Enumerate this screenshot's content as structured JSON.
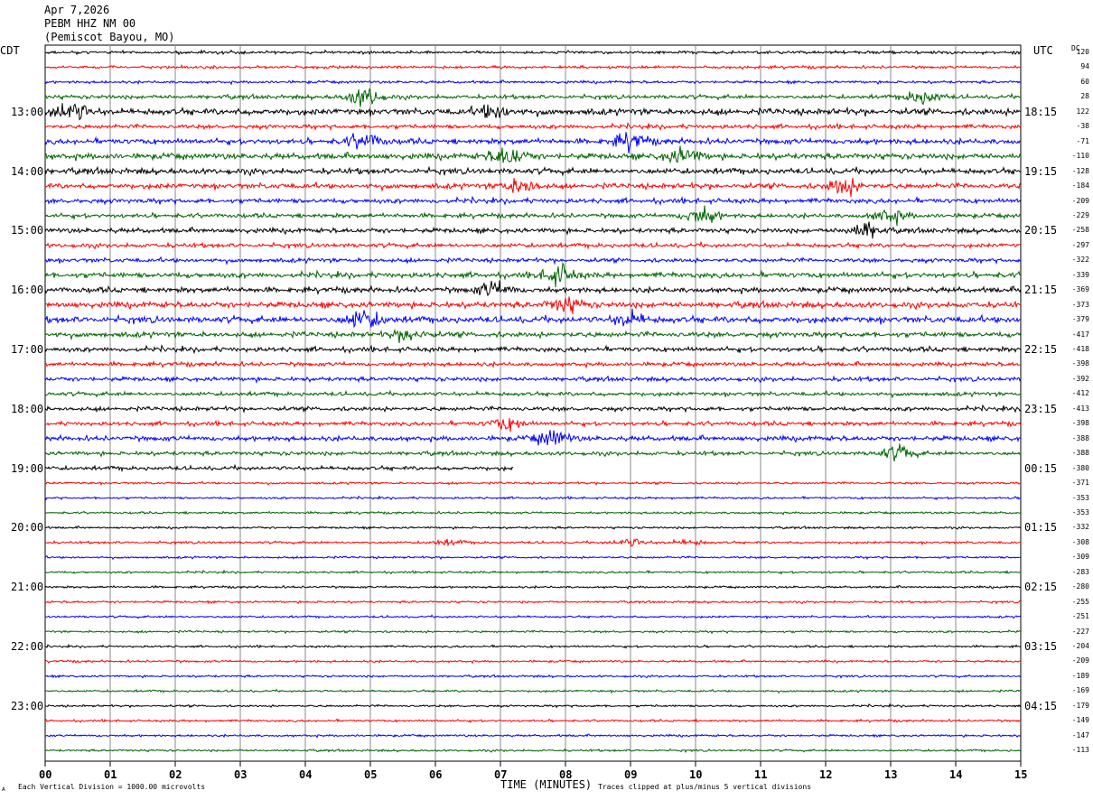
{
  "header": {
    "date": "Apr 7,2026",
    "station": "PEBM HHZ NM 00",
    "location": "(Pemiscot Bayou, MO)"
  },
  "left_tz": "CDT",
  "right_tz": "UTC",
  "dc_label": "DC",
  "footer": {
    "scale_note": "Each Vertical Division = 1000.00 microvolts",
    "clip_note": "Traces clipped at plus/minus 5 vertical divisions",
    "corner_mark": "A"
  },
  "chart_data": {
    "type": "line",
    "title": "",
    "xlabel": "TIME (MINUTES)",
    "ylabel": "",
    "xlim": [
      0,
      15
    ],
    "x_ticks": [
      "00",
      "01",
      "02",
      "03",
      "04",
      "05",
      "06",
      "07",
      "08",
      "09",
      "10",
      "11",
      "12",
      "13",
      "14",
      "15"
    ],
    "grid": true,
    "trace_count": 48,
    "trace_color_cycle": [
      "#000000",
      "#ff0000",
      "#0000ff",
      "#006400"
    ],
    "left_hour_labels": [
      {
        "trace": 4,
        "label": "13:00"
      },
      {
        "trace": 8,
        "label": "14:00"
      },
      {
        "trace": 12,
        "label": "15:00"
      },
      {
        "trace": 16,
        "label": "16:00"
      },
      {
        "trace": 20,
        "label": "17:00"
      },
      {
        "trace": 24,
        "label": "18:00"
      },
      {
        "trace": 28,
        "label": "19:00"
      },
      {
        "trace": 32,
        "label": "20:00"
      },
      {
        "trace": 36,
        "label": "21:00"
      },
      {
        "trace": 40,
        "label": "22:00"
      },
      {
        "trace": 44,
        "label": "23:00"
      }
    ],
    "right_hour_labels": [
      {
        "trace": 4,
        "label": "18:15"
      },
      {
        "trace": 8,
        "label": "19:15"
      },
      {
        "trace": 12,
        "label": "20:15"
      },
      {
        "trace": 16,
        "label": "21:15"
      },
      {
        "trace": 20,
        "label": "22:15"
      },
      {
        "trace": 24,
        "label": "23:15"
      },
      {
        "trace": 28,
        "label": "00:15"
      },
      {
        "trace": 32,
        "label": "01:15"
      },
      {
        "trace": 36,
        "label": "02:15"
      },
      {
        "trace": 40,
        "label": "03:15"
      },
      {
        "trace": 44,
        "label": "04:15"
      }
    ],
    "dc_offsets": [
      "120",
      "94",
      "60",
      "28",
      "122",
      "-38",
      "-71",
      "-110",
      "-128",
      "-184",
      "-209",
      "-229",
      "-258",
      "-297",
      "-322",
      "-339",
      "-369",
      "-373",
      "-379",
      "-417",
      "-418",
      "-398",
      "-392",
      "-412",
      "-413",
      "-398",
      "-388",
      "-388",
      "-380",
      "-371",
      "-353",
      "-353",
      "-332",
      "-308",
      "-309",
      "-283",
      "-280",
      "-255",
      "-251",
      "-227",
      "-204",
      "-209",
      "-189",
      "-169",
      "-179",
      "-149",
      "-147",
      "-113"
    ],
    "trace_amplitude": [
      1.1,
      1.0,
      1.0,
      1.5,
      2.4,
      1.6,
      2.0,
      2.2,
      2.2,
      2.0,
      1.8,
      1.6,
      1.8,
      1.6,
      1.6,
      2.0,
      2.0,
      2.2,
      2.4,
      2.0,
      1.8,
      1.5,
      1.6,
      1.5,
      1.6,
      1.5,
      1.8,
      1.5,
      1.5,
      0.8,
      0.8,
      0.8,
      0.8,
      0.9,
      0.8,
      0.8,
      0.8,
      0.8,
      0.8,
      0.8,
      0.8,
      0.8,
      0.8,
      0.8,
      0.8,
      0.8,
      0.8,
      0.8
    ],
    "events": [
      {
        "trace": 3,
        "minute": 4.9,
        "amplitude": 8
      },
      {
        "trace": 3,
        "minute": 13.5,
        "amplitude": 5
      },
      {
        "trace": 4,
        "minute": 0.4,
        "amplitude": 8
      },
      {
        "trace": 4,
        "minute": 6.9,
        "amplitude": 5
      },
      {
        "trace": 6,
        "minute": 4.9,
        "amplitude": 6
      },
      {
        "trace": 6,
        "minute": 9.0,
        "amplitude": 6
      },
      {
        "trace": 7,
        "minute": 7.1,
        "amplitude": 7
      },
      {
        "trace": 7,
        "minute": 9.8,
        "amplitude": 6
      },
      {
        "trace": 9,
        "minute": 7.3,
        "amplitude": 6
      },
      {
        "trace": 9,
        "minute": 12.3,
        "amplitude": 6
      },
      {
        "trace": 11,
        "minute": 10.1,
        "amplitude": 6
      },
      {
        "trace": 11,
        "minute": 13.0,
        "amplitude": 5
      },
      {
        "trace": 12,
        "minute": 12.6,
        "amplitude": 6
      },
      {
        "trace": 15,
        "minute": 7.9,
        "amplitude": 7
      },
      {
        "trace": 16,
        "minute": 6.9,
        "amplitude": 6
      },
      {
        "trace": 17,
        "minute": 8.0,
        "amplitude": 6
      },
      {
        "trace": 18,
        "minute": 4.9,
        "amplitude": 8
      },
      {
        "trace": 18,
        "minute": 9.0,
        "amplitude": 5
      },
      {
        "trace": 19,
        "minute": 5.6,
        "amplitude": 5
      },
      {
        "trace": 25,
        "minute": 7.1,
        "amplitude": 5
      },
      {
        "trace": 26,
        "minute": 7.8,
        "amplitude": 6
      },
      {
        "trace": 27,
        "minute": 13.1,
        "amplitude": 5
      },
      {
        "trace": 33,
        "minute": 9.0,
        "amplitude": 3
      },
      {
        "trace": 33,
        "minute": 6.2,
        "amplitude": 2
      },
      {
        "trace": 33,
        "minute": 9.9,
        "amplitude": 2
      }
    ],
    "partial_trace": {
      "trace": 28,
      "end_minute": 7.2
    }
  }
}
